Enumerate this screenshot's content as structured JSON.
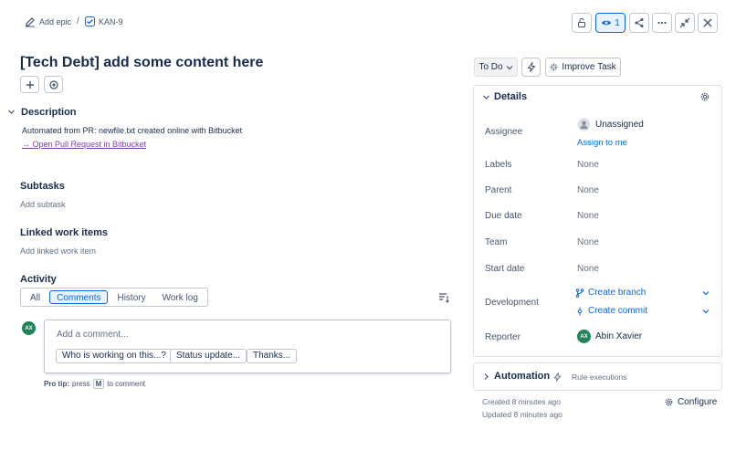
{
  "breadcrumb": {
    "add_epic": "Add epic",
    "separator": "/",
    "issue_key": "KAN-9"
  },
  "header": {
    "watch_count": "1"
  },
  "title": "[Tech Debt] add some content here",
  "status": {
    "label": "To Do",
    "improve_label": "Improve Task"
  },
  "description": {
    "heading": "Description",
    "text": "Automated from PR: newfile.txt created online with Bitbucket",
    "link": "→ Open Pull Request in Bitbucket"
  },
  "subtasks": {
    "heading": "Subtasks",
    "placeholder": "Add subtask"
  },
  "linked": {
    "heading": "Linked work items",
    "placeholder": "Add linked work item"
  },
  "activity": {
    "heading": "Activity",
    "tabs": [
      "All",
      "Comments",
      "History",
      "Work log"
    ],
    "comment_placeholder": "Add a comment...",
    "quick_replies": [
      "Who is working on this...?",
      "Status update...",
      "Thanks..."
    ],
    "pro_tip_label": "Pro tip:",
    "pro_tip_text1": "press",
    "pro_tip_key": "M",
    "pro_tip_text2": "to comment",
    "avatar_initials": "AX"
  },
  "details": {
    "heading": "Details",
    "assignee_label": "Assignee",
    "assignee_value": "Unassigned",
    "assign_to_me": "Assign to me",
    "labels_label": "Labels",
    "labels_value": "None",
    "parent_label": "Parent",
    "parent_value": "None",
    "due_label": "Due date",
    "due_value": "None",
    "team_label": "Team",
    "team_value": "None",
    "start_label": "Start date",
    "start_value": "None",
    "development_label": "Development",
    "create_branch": "Create branch",
    "create_commit": "Create commit",
    "reporter_label": "Reporter",
    "reporter_value": "Abin Xavier",
    "reporter_initials": "AX"
  },
  "automation": {
    "heading": "Automation",
    "rule_executions": "Rule executions"
  },
  "meta": {
    "created": "Created 8 minutes ago",
    "updated": "Updated 8 minutes ago",
    "configure": "Configure"
  },
  "colors": {
    "accent": "#0c66e4",
    "avatar": "#1f845a",
    "link_visited": "#803fa5"
  }
}
